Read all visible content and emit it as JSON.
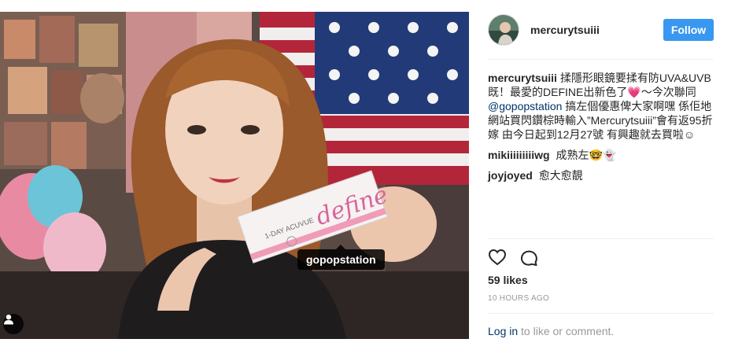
{
  "photo": {
    "tag_label": "gopopstation",
    "user_tag_icon": "person-icon",
    "box_brand": "1-DAY ACUVUE",
    "box_product": "define"
  },
  "header": {
    "username": "mercurytsuiii",
    "follow_label": "Follow"
  },
  "comments": [
    {
      "user": "mercurytsuiii",
      "text_1": "揉隱形眼鏡要揉有防UVA&UVB既！最愛的DEFINE出新色了💗～今次聯同",
      "mention": "@gopopstation",
      "text_2": "搞左個優惠俾大家啊嘿 係佢地網站買閃鑽棕時輸入”Mercurytsuiii”會有返95折嫁 由今日起到12月27號 有興趣就去買啦☺"
    },
    {
      "user": "mikiiiiiiiiiwg",
      "text": "成熟左🤓👻"
    },
    {
      "user": "joyjoyed",
      "text": "愈大愈靚"
    }
  ],
  "actions": {
    "like_icon": "heart-icon",
    "comment_icon": "comment-icon"
  },
  "likes": "59 likes",
  "time": "10 HOURS AGO",
  "login": {
    "link": "Log in",
    "rest": " to like or comment."
  },
  "colors": {
    "follow_button": "#3897f0",
    "link": "#003569",
    "muted": "#999999"
  }
}
